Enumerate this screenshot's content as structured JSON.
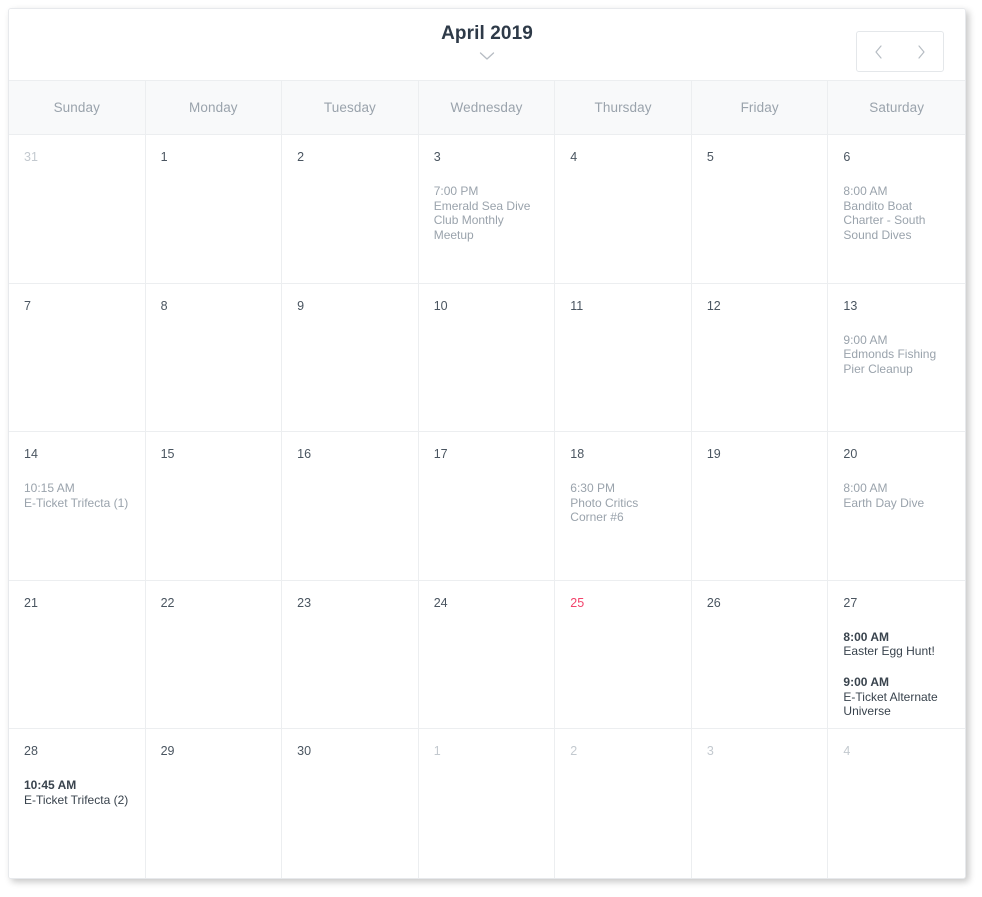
{
  "toolbar": {
    "title": "April 2019",
    "title_chevron_icon": "chevron-down-icon",
    "prev_icon": "chevron-left-icon",
    "next_icon": "chevron-right-icon"
  },
  "weekdays": [
    "Sunday",
    "Monday",
    "Tuesday",
    "Wednesday",
    "Thursday",
    "Friday",
    "Saturday"
  ],
  "colors": {
    "today": "#f2436b",
    "text": "#39434d",
    "muted": "#9aa3ac",
    "other_month": "#c3c9cf",
    "border": "#eceef0",
    "header_bg": "#f8f9fa"
  },
  "weeks": [
    [
      {
        "day": "31",
        "other_month": true,
        "today": false,
        "events": []
      },
      {
        "day": "1",
        "other_month": false,
        "today": false,
        "events": []
      },
      {
        "day": "2",
        "other_month": false,
        "today": false,
        "events": []
      },
      {
        "day": "3",
        "other_month": false,
        "today": false,
        "events": [
          {
            "time": "7:00 PM",
            "title": "Emerald Sea Dive Club Monthly Meetup",
            "past": true
          }
        ]
      },
      {
        "day": "4",
        "other_month": false,
        "today": false,
        "events": []
      },
      {
        "day": "5",
        "other_month": false,
        "today": false,
        "events": []
      },
      {
        "day": "6",
        "other_month": false,
        "today": false,
        "events": [
          {
            "time": "8:00 AM",
            "title": "Bandito Boat Charter - South Sound Dives",
            "past": true
          }
        ]
      }
    ],
    [
      {
        "day": "7",
        "other_month": false,
        "today": false,
        "events": []
      },
      {
        "day": "8",
        "other_month": false,
        "today": false,
        "events": []
      },
      {
        "day": "9",
        "other_month": false,
        "today": false,
        "events": []
      },
      {
        "day": "10",
        "other_month": false,
        "today": false,
        "events": []
      },
      {
        "day": "11",
        "other_month": false,
        "today": false,
        "events": []
      },
      {
        "day": "12",
        "other_month": false,
        "today": false,
        "events": []
      },
      {
        "day": "13",
        "other_month": false,
        "today": false,
        "events": [
          {
            "time": "9:00 AM",
            "title": "Edmonds Fishing Pier Cleanup",
            "past": true
          }
        ]
      }
    ],
    [
      {
        "day": "14",
        "other_month": false,
        "today": false,
        "events": [
          {
            "time": "10:15 AM",
            "title": "E-Ticket Trifecta (1)",
            "past": true
          }
        ]
      },
      {
        "day": "15",
        "other_month": false,
        "today": false,
        "events": []
      },
      {
        "day": "16",
        "other_month": false,
        "today": false,
        "events": []
      },
      {
        "day": "17",
        "other_month": false,
        "today": false,
        "events": []
      },
      {
        "day": "18",
        "other_month": false,
        "today": false,
        "events": [
          {
            "time": "6:30 PM",
            "title": "Photo Critics Corner #6",
            "past": true
          }
        ]
      },
      {
        "day": "19",
        "other_month": false,
        "today": false,
        "events": []
      },
      {
        "day": "20",
        "other_month": false,
        "today": false,
        "events": [
          {
            "time": "8:00 AM",
            "title": "Earth Day Dive",
            "past": true
          }
        ]
      }
    ],
    [
      {
        "day": "21",
        "other_month": false,
        "today": false,
        "events": []
      },
      {
        "day": "22",
        "other_month": false,
        "today": false,
        "events": []
      },
      {
        "day": "23",
        "other_month": false,
        "today": false,
        "events": []
      },
      {
        "day": "24",
        "other_month": false,
        "today": false,
        "events": []
      },
      {
        "day": "25",
        "other_month": false,
        "today": true,
        "events": []
      },
      {
        "day": "26",
        "other_month": false,
        "today": false,
        "events": []
      },
      {
        "day": "27",
        "other_month": false,
        "today": false,
        "events": [
          {
            "time": "8:00 AM",
            "title": "Easter Egg Hunt!",
            "past": false
          },
          {
            "time": "9:00 AM",
            "title": "E-Ticket Alternate Universe",
            "past": false
          }
        ]
      }
    ],
    [
      {
        "day": "28",
        "other_month": false,
        "today": false,
        "events": [
          {
            "time": "10:45 AM",
            "title": "E-Ticket Trifecta (2)",
            "past": false
          }
        ]
      },
      {
        "day": "29",
        "other_month": false,
        "today": false,
        "events": []
      },
      {
        "day": "30",
        "other_month": false,
        "today": false,
        "events": []
      },
      {
        "day": "1",
        "other_month": true,
        "today": false,
        "events": []
      },
      {
        "day": "2",
        "other_month": true,
        "today": false,
        "events": []
      },
      {
        "day": "3",
        "other_month": true,
        "today": false,
        "events": []
      },
      {
        "day": "4",
        "other_month": true,
        "today": false,
        "events": []
      }
    ]
  ]
}
